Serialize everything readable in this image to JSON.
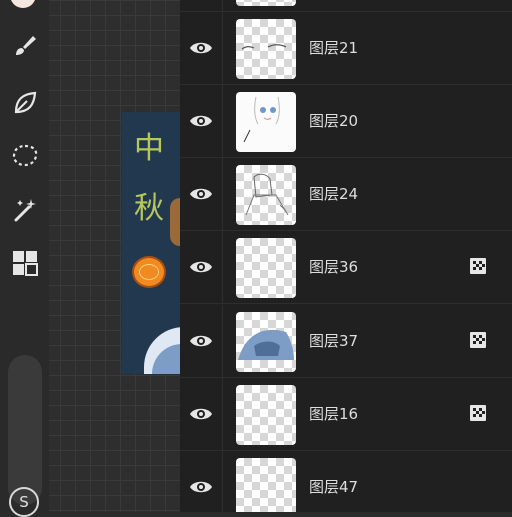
{
  "canvas": {
    "artwork_text": [
      "中",
      "秋"
    ]
  },
  "toolbar": {
    "items": [
      {
        "name": "brush-icon"
      },
      {
        "name": "smudge-leaf-icon"
      },
      {
        "name": "lasso-select-icon"
      },
      {
        "name": "magic-wand-icon"
      },
      {
        "name": "layers-grid-icon"
      }
    ],
    "bottom_button_label": "S"
  },
  "layers": [
    {
      "name": "图层21",
      "thumb": "eyes-sketch",
      "blend_icon": false
    },
    {
      "name": "图层20",
      "thumb": "character-color",
      "blend_icon": false
    },
    {
      "name": "图层24",
      "thumb": "line-sketch",
      "blend_icon": false
    },
    {
      "name": "图层36",
      "thumb": "transparent",
      "blend_icon": true
    },
    {
      "name": "图层37",
      "thumb": "blue-cloth",
      "blend_icon": true
    },
    {
      "name": "图层16",
      "thumb": "transparent",
      "blend_icon": true
    },
    {
      "name": "图层47",
      "thumb": "transparent",
      "blend_icon": false
    }
  ],
  "colors": {
    "panel_bg": "#202020",
    "toolbar_bg": "#2a2a2a",
    "icon_color": "#e6e6e6"
  }
}
